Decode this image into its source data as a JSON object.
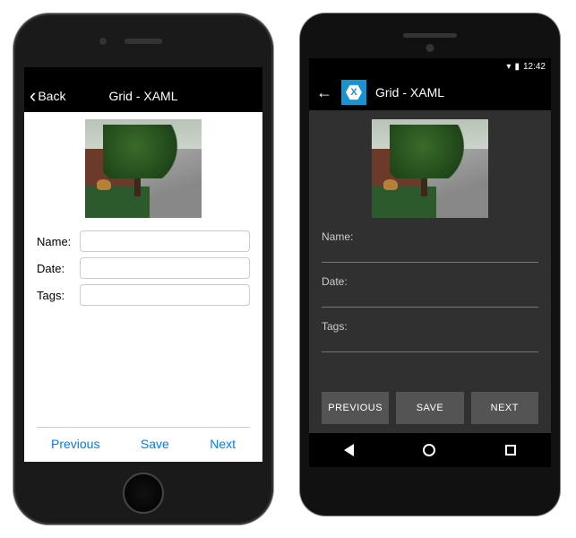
{
  "ios": {
    "back_label": "Back",
    "title": "Grid - XAML",
    "labels": {
      "name": "Name:",
      "date": "Date:",
      "tags": "Tags:"
    },
    "values": {
      "name": "",
      "date": "",
      "tags": ""
    },
    "toolbar": {
      "previous": "Previous",
      "save": "Save",
      "next": "Next"
    }
  },
  "android": {
    "status_time": "12:42",
    "title": "Grid - XAML",
    "labels": {
      "name": "Name:",
      "date": "Date:",
      "tags": "Tags:"
    },
    "values": {
      "name": "",
      "date": "",
      "tags": ""
    },
    "buttons": {
      "previous": "PREVIOUS",
      "save": "SAVE",
      "next": "NEXT"
    }
  }
}
